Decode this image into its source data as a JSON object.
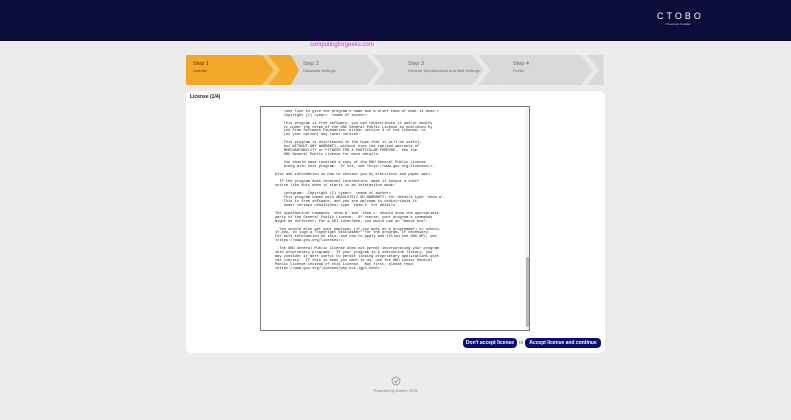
{
  "brand": {
    "logo": "CTOBO",
    "sub": "Chevereto Installer"
  },
  "watermark": "computingforgeeks.com",
  "steps": [
    {
      "number": "Step 1",
      "name": "License",
      "active": true
    },
    {
      "number": "Step 2",
      "name": "Database Settings",
      "active": false
    },
    {
      "number": "Step 3",
      "name": "General Specifications and Mail Settings",
      "active": false
    },
    {
      "number": "Step 4",
      "name": "Finish",
      "active": false
    }
  ],
  "license": {
    "title": "License (1/4)",
    "text": "the \"copyright\" line and a pointer to where the full notice is found.\n\n    <one line to give the program's name and a brief idea of what it does.>\n    Copyright (C) <year>  <name of author>\n\n    This program is free software: you can redistribute it and/or modify\n    it under the terms of the GNU General Public License as published by\n    the Free Software Foundation, either version 3 of the License, or\n    (at your option) any later version.\n\n    This program is distributed in the hope that it will be useful,\n    but WITHOUT ANY WARRANTY; without even the implied warranty of\n    MERCHANTABILITY or FITNESS FOR A PARTICULAR PURPOSE.  See the\n    GNU General Public License for more details.\n\n    You should have received a copy of the GNU General Public License\n    along with this program.  If not, see <http://www.gnu.org/licenses/>.\n\nAlso add information on how to contact you by electronic and paper mail.\n\n  If the program does terminal interaction, make it output a short\nnotice like this when it starts in an interactive mode:\n\n    <program>  Copyright (C) <year>  <name of author>\n    This program comes with ABSOLUTELY NO WARRANTY; for details type `show w'.\n    This is free software, and you are welcome to redistribute it\n    under certain conditions; type `show c' for details.\n\nThe hypothetical commands `show w' and `show c' should show the appropriate\nparts of the General Public License.  Of course, your program's commands\nmight be different; for a GUI interface, you would use an \"about box\".\n\n  You should also get your employer (if you work as a programmer) or school,\nif any, to sign a \"copyright disclaimer\" for the program, if necessary.\nFor more information on this, and how to apply and follow the GNU GPL, see\n<https://www.gnu.org/licenses/>.\n\n  The GNU General Public License does not permit incorporating your program\ninto proprietary programs.  If your program is a subroutine library, you\nmay consider it more useful to permit linking proprietary applications with\nthe library.  If this is what you want to do, use the GNU Lesser General\nPublic License instead of this License.  But first, please read\n<https://www.gnu.org/licenses/why-not-lgpl.html>."
  },
  "actions": {
    "decline_label": "Don't accept license",
    "or_label": "or",
    "accept_label": "Accept license and continue"
  },
  "footer": {
    "text": "Powered by Rother OSS",
    "icon": "check-circle-icon"
  },
  "colors": {
    "topbar": "#0b0c3a",
    "active_step": "#f4a82b",
    "button": "#0b0c72",
    "watermark": "#d22fd9"
  }
}
